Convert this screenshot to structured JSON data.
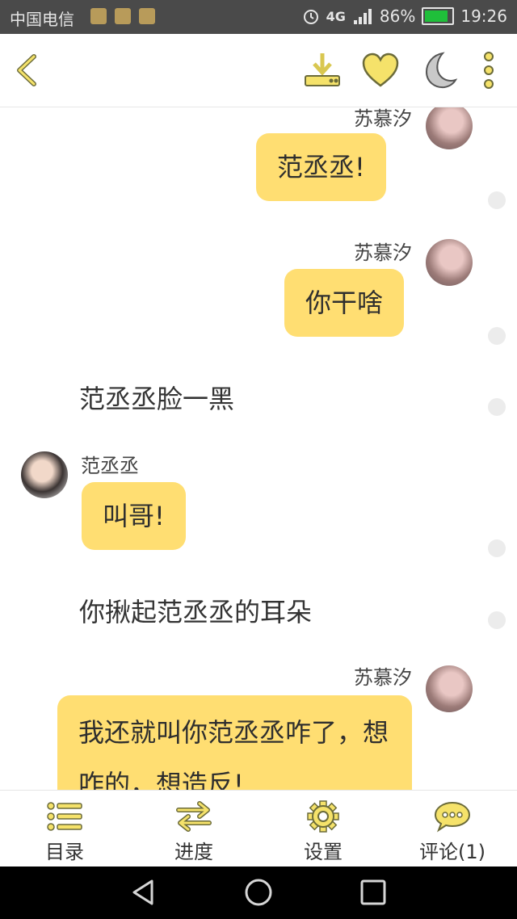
{
  "status_bar": {
    "carrier": "中国电信",
    "network": "4G",
    "battery": "86%",
    "time": "19:26"
  },
  "top_bar": {
    "icons": [
      "back-icon",
      "download-icon",
      "heart-icon",
      "moon-icon",
      "more-icon"
    ]
  },
  "colors": {
    "accent": "#ffde72",
    "icon_yellow": "#f5e26a",
    "icon_outline": "#6b6b3a"
  },
  "chat": {
    "m1": {
      "speaker": "苏慕汐",
      "text": "范丞丞!"
    },
    "m2": {
      "speaker": "苏慕汐",
      "text": "你干啥"
    },
    "n1": {
      "text": "范丞丞脸一黑"
    },
    "m3": {
      "speaker": "范丞丞",
      "text": "叫哥!"
    },
    "n2": {
      "text": "你揪起范丞丞的耳朵"
    },
    "m4": {
      "speaker": "苏慕汐",
      "text": "我还就叫你范丞丞咋了，想咋的，想造反!"
    }
  },
  "bottom_nav": {
    "catalog": "目录",
    "progress": "进度",
    "settings": "设置",
    "comments": "评论(1)"
  }
}
